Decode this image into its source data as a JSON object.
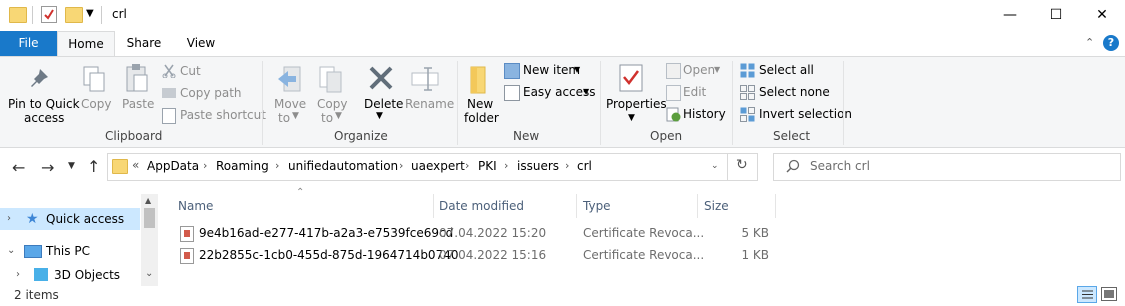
{
  "window": {
    "title": "crl",
    "minimize": "—",
    "maximize": "☐",
    "close": "✕"
  },
  "tabs": {
    "file": "File",
    "home": "Home",
    "share": "Share",
    "view": "View"
  },
  "ribbon": {
    "clipboard": {
      "group": "Clipboard",
      "pin_line1": "Pin to Quick",
      "pin_line2": "access",
      "copy": "Copy",
      "paste": "Paste",
      "cut": "Cut",
      "copy_path": "Copy path",
      "paste_shortcut": "Paste shortcut"
    },
    "organize": {
      "group": "Organize",
      "move_to": "Move",
      "move_to2": "to",
      "copy_to": "Copy",
      "copy_to2": "to",
      "delete": "Delete",
      "rename": "Rename"
    },
    "new": {
      "group": "New",
      "new_folder1": "New",
      "new_folder2": "folder",
      "new_item": "New item",
      "easy_access": "Easy access"
    },
    "open": {
      "group": "Open",
      "properties": "Properties",
      "open": "Open",
      "edit": "Edit",
      "history": "History"
    },
    "select": {
      "group": "Select",
      "select_all": "Select all",
      "select_none": "Select none",
      "invert": "Invert selection"
    }
  },
  "address": {
    "overflow": "«",
    "crumbs": [
      "AppData",
      "Roaming",
      "unifiedautomation",
      "uaexpert",
      "PKI",
      "issuers",
      "crl"
    ],
    "search_placeholder": "Search crl"
  },
  "nav": {
    "quick_access": "Quick access",
    "this_pc": "This PC",
    "objects_3d": "3D Objects"
  },
  "columns": {
    "name": "Name",
    "date": "Date modified",
    "type": "Type",
    "size": "Size"
  },
  "files": [
    {
      "name": "9e4b16ad-e277-417b-a2a3-e7539fce69cd",
      "date": "07.04.2022 15:20",
      "type": "Certificate Revoca...",
      "size": "5 KB"
    },
    {
      "name": "22b2855c-1cb0-455d-875d-1964714b0740",
      "date": "07.04.2022 15:16",
      "type": "Certificate Revoca...",
      "size": "1 KB"
    }
  ],
  "status": {
    "items": "2 items"
  },
  "colors": {
    "file_tab": "#1979ca",
    "ribbon_bg": "#f5f6f7",
    "folder": "#f8d775"
  }
}
